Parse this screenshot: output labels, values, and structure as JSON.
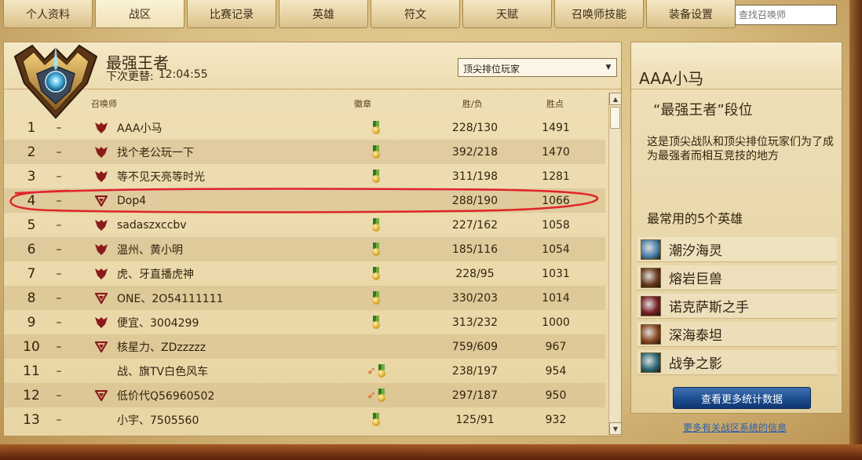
{
  "tabs": [
    {
      "label": "个人资料",
      "active": false
    },
    {
      "label": "战区",
      "active": true
    },
    {
      "label": "比赛记录",
      "active": false
    },
    {
      "label": "英雄",
      "active": false
    },
    {
      "label": "符文",
      "active": false
    },
    {
      "label": "天赋",
      "active": false
    },
    {
      "label": "召唤师技能",
      "active": false
    },
    {
      "label": "装备设置",
      "active": false
    }
  ],
  "search": {
    "placeholder": "查找召唤师"
  },
  "ladder": {
    "tier_title": "最强王者",
    "refresh_label": "下次更替:",
    "refresh_time": "12:04:55",
    "queue_select": "顶尖排位玩家",
    "columns": {
      "summoner": "召唤师",
      "badges": "徽章",
      "record": "胜/负",
      "points": "胜点"
    },
    "rows": [
      {
        "rank": "1",
        "change": "–",
        "tier_icon": "full",
        "name": "AAA小马",
        "badges": [
          "medal"
        ],
        "record": "228/130",
        "points": "1491"
      },
      {
        "rank": "2",
        "change": "–",
        "tier_icon": "full",
        "name": "找个老公玩一下",
        "badges": [
          "medal"
        ],
        "record": "392/218",
        "points": "1470"
      },
      {
        "rank": "3",
        "change": "–",
        "tier_icon": "full",
        "name": "等不见天亮等时光",
        "badges": [
          "medal"
        ],
        "record": "311/198",
        "points": "1281"
      },
      {
        "rank": "4",
        "change": "–",
        "tier_icon": "outline",
        "name": "Dop4",
        "badges": [],
        "record": "288/190",
        "points": "1066"
      },
      {
        "rank": "5",
        "change": "–",
        "tier_icon": "full",
        "name": "sadaszxccbv",
        "badges": [
          "medal"
        ],
        "record": "227/162",
        "points": "1058"
      },
      {
        "rank": "6",
        "change": "–",
        "tier_icon": "full",
        "name": "温州、黄小明",
        "badges": [
          "medal"
        ],
        "record": "185/116",
        "points": "1054"
      },
      {
        "rank": "7",
        "change": "–",
        "tier_icon": "full",
        "name": "虎、牙直播虎神",
        "badges": [
          "medal"
        ],
        "record": "228/95",
        "points": "1031"
      },
      {
        "rank": "8",
        "change": "–",
        "tier_icon": "outline",
        "name": "ONE、2O54111111",
        "badges": [
          "medal"
        ],
        "record": "330/203",
        "points": "1014"
      },
      {
        "rank": "9",
        "change": "–",
        "tier_icon": "full",
        "name": "便宜、3004299",
        "badges": [
          "medal"
        ],
        "record": "313/232",
        "points": "1000"
      },
      {
        "rank": "10",
        "change": "–",
        "tier_icon": "outline",
        "name": "核星力、ZDzzzzz",
        "badges": [],
        "record": "759/609",
        "points": "967"
      },
      {
        "rank": "11",
        "change": "–",
        "tier_icon": "none",
        "name": "战、旗TV白色风车",
        "badges": [
          "flame",
          "medal"
        ],
        "record": "238/197",
        "points": "954"
      },
      {
        "rank": "12",
        "change": "–",
        "tier_icon": "outline",
        "name": "低价代Q56960502",
        "badges": [
          "flame",
          "medal"
        ],
        "record": "297/187",
        "points": "950"
      },
      {
        "rank": "13",
        "change": "–",
        "tier_icon": "none",
        "name": "小宇、7505560",
        "badges": [
          "medal"
        ],
        "record": "125/91",
        "points": "932"
      }
    ]
  },
  "side": {
    "summoner_name": "AAA小马",
    "tier_label": "“最强王者”段位",
    "description": "这是顶尖战队和顶尖排位玩家们为了成为最强者而相互竞技的地方",
    "champions_title": "最常用的5个英雄",
    "champions": [
      {
        "name": "潮汐海灵",
        "color": "#4a7fa8"
      },
      {
        "name": "熔岩巨兽",
        "color": "#6b3a1e"
      },
      {
        "name": "诺克萨斯之手",
        "color": "#7a1e2a"
      },
      {
        "name": "深海泰坦",
        "color": "#8a4a22"
      },
      {
        "name": "战争之影",
        "color": "#2b6a76"
      }
    ],
    "stats_button": "查看更多统计数据",
    "more_link": "更多有关战区系统的信息"
  },
  "colors": {
    "tier_red": "#8b1a1a",
    "button_blue": "#1d4d8f",
    "highlight_red": "#e0242a"
  }
}
